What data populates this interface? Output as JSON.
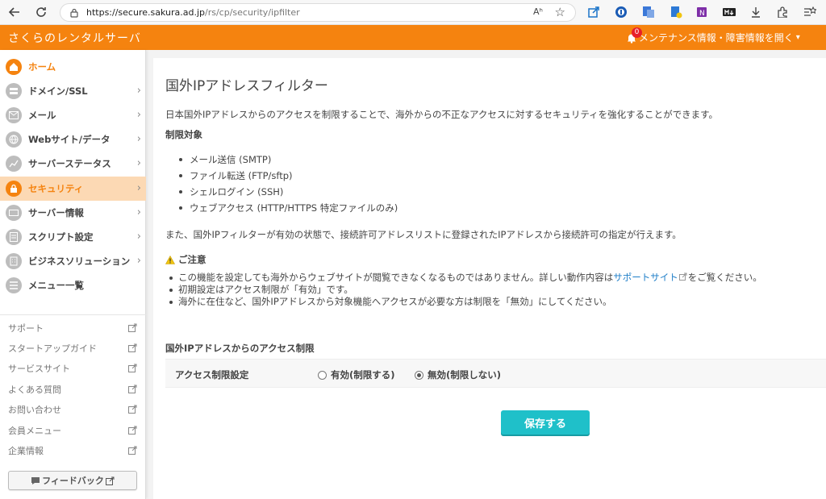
{
  "browser": {
    "url_host": "https://secure.sakura.ad.jp",
    "url_path": "/rs/cp/security/ipfilter",
    "reader_label": "Aʰ"
  },
  "header": {
    "title": "さくらのレンタルサーバ",
    "notification_count": "0",
    "maintenance_label": "メンテナンス情報・障害情報を開く"
  },
  "sidebar": {
    "items": [
      {
        "label": "ホーム"
      },
      {
        "label": "ドメイン/SSL"
      },
      {
        "label": "メール"
      },
      {
        "label": "Webサイト/データ"
      },
      {
        "label": "サーバーステータス"
      },
      {
        "label": "セキュリティ"
      },
      {
        "label": "サーバー情報"
      },
      {
        "label": "スクリプト設定"
      },
      {
        "label": "ビジネスソリューション"
      },
      {
        "label": "メニュー一覧"
      }
    ],
    "links": [
      {
        "label": "サポート"
      },
      {
        "label": "スタートアップガイド"
      },
      {
        "label": "サービスサイト"
      },
      {
        "label": "よくある質問"
      },
      {
        "label": "お問い合わせ"
      },
      {
        "label": "会員メニュー"
      },
      {
        "label": "企業情報"
      }
    ],
    "feedback_label": "フィードバック"
  },
  "main": {
    "title": "国外IPアドレスフィルター",
    "intro": "日本国外IPアドレスからのアクセスを制限することで、海外からの不正なアクセスに対するセキュリティを強化することができます。",
    "targets_heading": "制限対象",
    "targets": [
      "メール送信 (SMTP)",
      "ファイル転送 (FTP/sftp)",
      "シェルログイン (SSH)",
      "ウェブアクセス (HTTP/HTTPS 特定ファイルのみ)"
    ],
    "also_text": "また、国外IPフィルターが有効の状態で、接続許可アドレスリストに登録されたIPアドレスから接続許可の指定が行えます。",
    "caution_heading": "ご注意",
    "caution_1_pre": "この機能を設定しても海外からウェブサイトが閲覧できなくなるものではありません。詳しい動作内容は",
    "caution_1_link": "サポートサイト",
    "caution_1_post": "をご覧ください。",
    "caution_2": "初期設定はアクセス制限が「有効」です。",
    "caution_3": "海外に在住など、国外IPアドレスから対象機能へアクセスが必要な方は制限を「無効」にしてください。",
    "section_heading": "国外IPアドレスからのアクセス制限",
    "form_label": "アクセス制限設定",
    "radio_on_label": "有効(制限する)",
    "radio_off_label": "無効(制限しない)",
    "selected": "無効(制限しない)",
    "save_label": "保存する"
  },
  "colors": {
    "brand_orange": "#f5830f",
    "save_teal": "#1fc0c9",
    "link_blue": "#1e7ec8"
  }
}
